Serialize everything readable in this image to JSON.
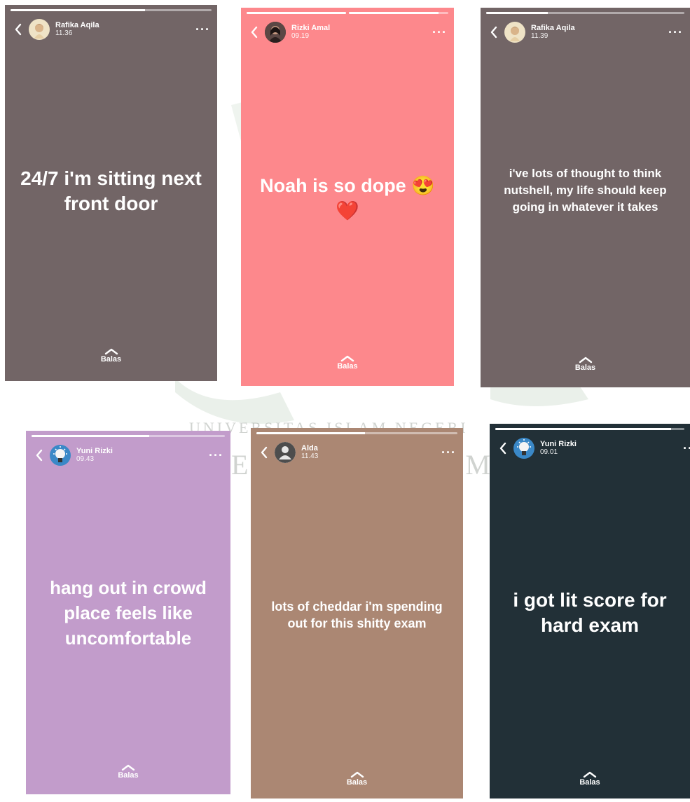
{
  "watermark": {
    "line1": "UNIVERSITAS ISLAM NEGERI",
    "line2": "E                               ME"
  },
  "stories": [
    {
      "bg": "#726566",
      "user": "Rafika Aqila",
      "time": "11.36",
      "caption": "24/7 i'm sitting next front door",
      "reply": "Balas",
      "avatar_icon": "girl-illustration-avatar",
      "progress": [
        0.67
      ]
    },
    {
      "bg": "#fd888c",
      "user": "Rizki Amal",
      "time": "09.19",
      "caption": "Noah is so dope 😍 ❤️",
      "reply": "Balas",
      "avatar_icon": "photo-avatar",
      "progress": [
        1.0,
        0.9
      ]
    },
    {
      "bg": "#726566",
      "user": "Rafika Aqila",
      "time": "11.39",
      "caption": "i've lots of thought to think nutshell, my life should keep going in whatever it takes",
      "reply": "Balas",
      "avatar_icon": "girl-illustration-avatar",
      "progress": [
        0.31
      ]
    },
    {
      "bg": "#c29ccb",
      "user": "Yuni Rizki",
      "time": "09.43",
      "caption": "hang out in crowd place feels like uncomfortable",
      "reply": "Balas",
      "avatar_icon": "bulb-avatar",
      "progress": [
        0.61
      ]
    },
    {
      "bg": "#ab8773",
      "user": "Alda",
      "time": "11.43",
      "caption": "lots of cheddar i'm spending out for this shitty exam",
      "reply": "Balas",
      "avatar_icon": "default-person-avatar",
      "progress": [
        0.54
      ]
    },
    {
      "bg": "#223037",
      "user": "Yuni Rizki",
      "time": "09.01",
      "caption": "i got lit score for hard exam",
      "reply": "Balas",
      "avatar_icon": "bulb-avatar",
      "progress": [
        0.93
      ]
    }
  ]
}
